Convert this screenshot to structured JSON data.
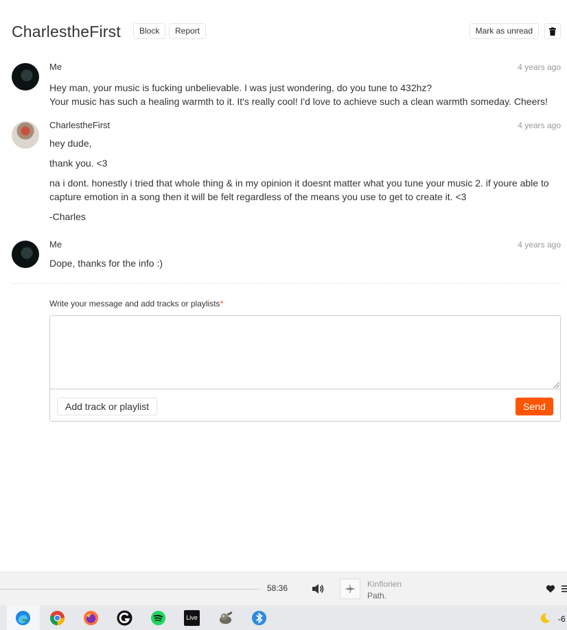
{
  "conversation": {
    "title": "CharlestheFirst",
    "block_label": "Block",
    "report_label": "Report",
    "mark_unread_label": "Mark as unread"
  },
  "messages": [
    {
      "author": "Me",
      "time": "4 years ago",
      "lines": [
        "Hey man, your music is fucking unbelievable. I was just wondering, do you tune to 432hz?",
        "Your music has such a healing warmth to it. It's really cool! I'd love to achieve such a clean warmth someday. Cheers!"
      ]
    },
    {
      "author": "CharlestheFirst",
      "time": "4 years ago",
      "paragraphs": [
        "hey dude,",
        "thank you. <3",
        "na i dont. honestly i tried that whole thing & in my opinion it doesnt matter what you tune your music 2. if youre able to capture emotion in a song then it will be felt regardless of the means you use to get to create it. <3",
        "-Charles"
      ]
    },
    {
      "author": "Me",
      "time": "4 years ago",
      "lines": [
        "Dope, thanks for the info :)"
      ]
    }
  ],
  "compose": {
    "label": "Write your message and add tracks or playlists",
    "required_mark": "*",
    "add_track_label": "Add track or playlist",
    "send_label": "Send"
  },
  "player": {
    "duration": "58:36",
    "artist": "Kinflorien",
    "track": "Path."
  },
  "taskbar": {
    "apps": [
      "edge-icon",
      "chrome-icon",
      "firefox-icon",
      "g-app-icon",
      "spotify-icon",
      "ableton-live-icon",
      "gimp-icon",
      "bluetooth-app-icon"
    ],
    "live_text": "Live",
    "temperature": "-6"
  },
  "colors": {
    "accent": "#ff5500",
    "text": "#333333",
    "muted": "#999999"
  }
}
